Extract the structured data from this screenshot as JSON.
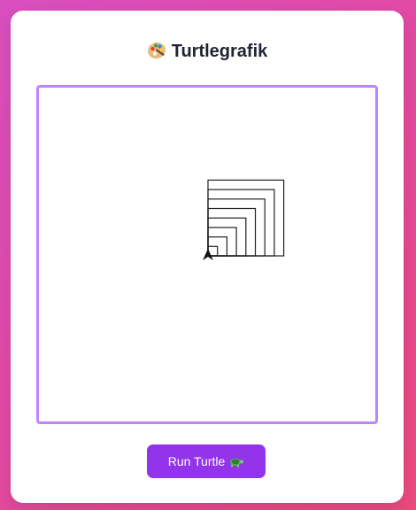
{
  "app": {
    "title": "Turtlegrafik",
    "title_icon": "palette-icon"
  },
  "canvas": {
    "drawing": "nested-squares",
    "square_count": 8,
    "turtle_icon": "turtle-cursor-icon"
  },
  "actions": {
    "run_label": "Run Turtle",
    "run_icon": "turtle-icon"
  },
  "colors": {
    "accent": "#9333ea",
    "frame_border": "#c084fc",
    "line": "#222222"
  }
}
